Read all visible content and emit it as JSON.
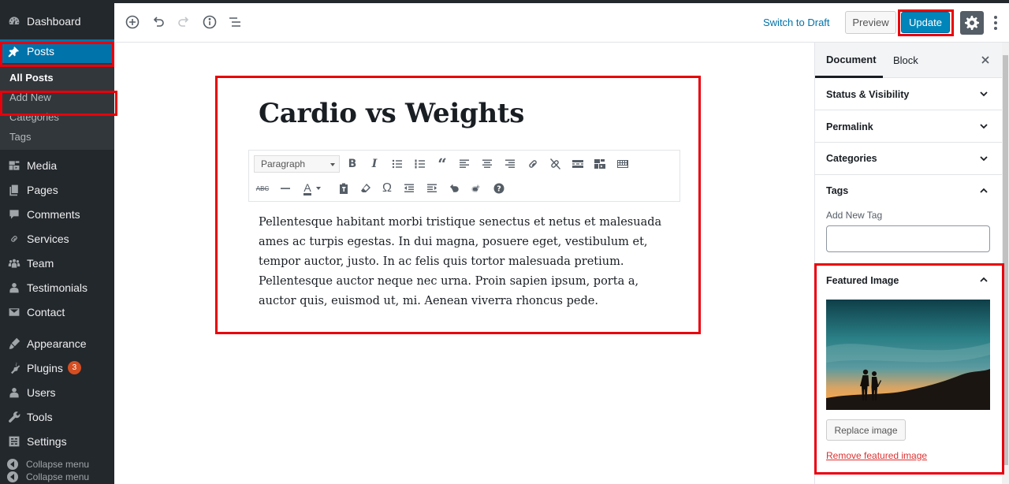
{
  "sidebar": {
    "items": [
      {
        "label": "Dashboard",
        "icon": "dashboard-icon"
      },
      {
        "label": "Posts",
        "icon": "pin-icon"
      },
      {
        "label": "Media",
        "icon": "media-icon"
      },
      {
        "label": "Pages",
        "icon": "pages-icon"
      },
      {
        "label": "Comments",
        "icon": "comment-icon"
      },
      {
        "label": "Services",
        "icon": "link-icon"
      },
      {
        "label": "Team",
        "icon": "team-icon"
      },
      {
        "label": "Testimonials",
        "icon": "user-icon"
      },
      {
        "label": "Contact",
        "icon": "mail-icon"
      },
      {
        "label": "Appearance",
        "icon": "brush-icon"
      },
      {
        "label": "Plugins",
        "icon": "plug-icon",
        "badge": "3"
      },
      {
        "label": "Users",
        "icon": "user-icon"
      },
      {
        "label": "Tools",
        "icon": "wrench-icon"
      },
      {
        "label": "Settings",
        "icon": "settings-icon"
      }
    ],
    "submenu": [
      "All Posts",
      "Add New",
      "Categories",
      "Tags"
    ],
    "collapse_label": "Collapse menu"
  },
  "toolbar": {
    "switch_draft": "Switch to Draft",
    "preview": "Preview",
    "update": "Update"
  },
  "editor": {
    "title": "Cardio vs Weights",
    "format_select": "Paragraph",
    "body": "Pellentesque habitant morbi tristique senectus et netus et malesuada  ames ac turpis egestas. In dui magna, posuere eget, vestibulum et, tempor auctor, justo. In ac felis quis tortor malesuada pretium. Pellentesque auctor neque nec urna. Proin sapien ipsum, porta a, auctor quis, euismod ut, mi. Aenean viverra rhoncus pede."
  },
  "panel": {
    "tabs": [
      "Document",
      "Block"
    ],
    "sections": [
      "Status & Visibility",
      "Permalink",
      "Categories",
      "Tags"
    ],
    "tags_add_label": "Add New Tag",
    "featured_image_title": "Featured Image",
    "replace_image": "Replace image",
    "remove_image": "Remove featured image"
  },
  "colors": {
    "sidebar_bg": "#23282d",
    "accent": "#0073aa",
    "update_button": "#0085ba",
    "highlight_red": "#e8000b"
  }
}
